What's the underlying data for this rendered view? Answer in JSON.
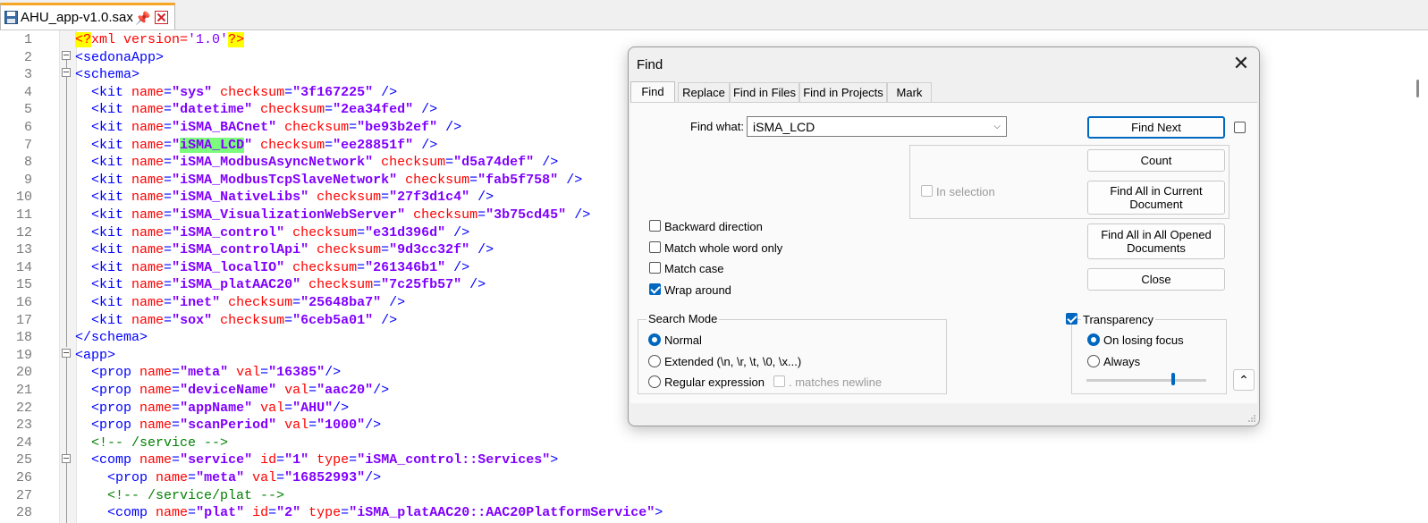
{
  "tab": {
    "filename": "AHU_app-v1.0.sax"
  },
  "editor": {
    "lines": [
      {
        "n": "1",
        "html": "<span class='pi'>&lt;?</span><span class='pit'>xml version=</span><span class='v' style='font-weight:normal;color:#8000ff'>'1.0'</span><span class='pi'>?&gt;</span>"
      },
      {
        "n": "2",
        "html": "<span class='t'>&lt;sedonaApp&gt;</span>"
      },
      {
        "n": "3",
        "html": "<span class='t'>&lt;schema&gt;</span>"
      },
      {
        "n": "4",
        "html": "  <span class='t'>&lt;kit </span><span class='a'>name</span><span class='t'>=</span><span class='v'>\"sys\"</span> <span class='a'>checksum</span><span class='t'>=</span><span class='v'>\"3f167225\"</span> <span class='t'>/&gt;</span>"
      },
      {
        "n": "5",
        "html": "  <span class='t'>&lt;kit </span><span class='a'>name</span><span class='t'>=</span><span class='v'>\"datetime\"</span> <span class='a'>checksum</span><span class='t'>=</span><span class='v'>\"2ea34fed\"</span> <span class='t'>/&gt;</span>"
      },
      {
        "n": "6",
        "html": "  <span class='t'>&lt;kit </span><span class='a'>name</span><span class='t'>=</span><span class='v'>\"iSMA_BACnet\"</span> <span class='a'>checksum</span><span class='t'>=</span><span class='v'>\"be93b2ef\"</span> <span class='t'>/&gt;</span>"
      },
      {
        "n": "7",
        "html": "  <span class='t'>&lt;kit </span><span class='a'>name</span><span class='t'>=</span><span class='v'>\"<span class='hl'>iSMA_LCD</span>\"</span> <span class='a'>checksum</span><span class='t'>=</span><span class='v'>\"ee28851f\"</span> <span class='t'>/&gt;</span>"
      },
      {
        "n": "8",
        "html": "  <span class='t'>&lt;kit </span><span class='a'>name</span><span class='t'>=</span><span class='v'>\"iSMA_ModbusAsyncNetwork\"</span> <span class='a'>checksum</span><span class='t'>=</span><span class='v'>\"d5a74def\"</span> <span class='t'>/&gt;</span>"
      },
      {
        "n": "9",
        "html": "  <span class='t'>&lt;kit </span><span class='a'>name</span><span class='t'>=</span><span class='v'>\"iSMA_ModbusTcpSlaveNetwork\"</span> <span class='a'>checksum</span><span class='t'>=</span><span class='v'>\"fab5f758\"</span> <span class='t'>/&gt;</span>"
      },
      {
        "n": "10",
        "html": "  <span class='t'>&lt;kit </span><span class='a'>name</span><span class='t'>=</span><span class='v'>\"iSMA_NativeLibs\"</span> <span class='a'>checksum</span><span class='t'>=</span><span class='v'>\"27f3d1c4\"</span> <span class='t'>/&gt;</span>"
      },
      {
        "n": "11",
        "html": "  <span class='t'>&lt;kit </span><span class='a'>name</span><span class='t'>=</span><span class='v'>\"iSMA_VisualizationWebServer\"</span> <span class='a'>checksum</span><span class='t'>=</span><span class='v'>\"3b75cd45\"</span> <span class='t'>/&gt;</span>"
      },
      {
        "n": "12",
        "html": "  <span class='t'>&lt;kit </span><span class='a'>name</span><span class='t'>=</span><span class='v'>\"iSMA_control\"</span> <span class='a'>checksum</span><span class='t'>=</span><span class='v'>\"e31d396d\"</span> <span class='t'>/&gt;</span>"
      },
      {
        "n": "13",
        "html": "  <span class='t'>&lt;kit </span><span class='a'>name</span><span class='t'>=</span><span class='v'>\"iSMA_controlApi\"</span> <span class='a'>checksum</span><span class='t'>=</span><span class='v'>\"9d3cc32f\"</span> <span class='t'>/&gt;</span>"
      },
      {
        "n": "14",
        "html": "  <span class='t'>&lt;kit </span><span class='a'>name</span><span class='t'>=</span><span class='v'>\"iSMA_localIO\"</span> <span class='a'>checksum</span><span class='t'>=</span><span class='v'>\"261346b1\"</span> <span class='t'>/&gt;</span>"
      },
      {
        "n": "15",
        "html": "  <span class='t'>&lt;kit </span><span class='a'>name</span><span class='t'>=</span><span class='v'>\"iSMA_platAAC20\"</span> <span class='a'>checksum</span><span class='t'>=</span><span class='v'>\"7c25fb57\"</span> <span class='t'>/&gt;</span>"
      },
      {
        "n": "16",
        "html": "  <span class='t'>&lt;kit </span><span class='a'>name</span><span class='t'>=</span><span class='v'>\"inet\"</span> <span class='a'>checksum</span><span class='t'>=</span><span class='v'>\"25648ba7\"</span> <span class='t'>/&gt;</span>"
      },
      {
        "n": "17",
        "html": "  <span class='t'>&lt;kit </span><span class='a'>name</span><span class='t'>=</span><span class='v'>\"sox\"</span> <span class='a'>checksum</span><span class='t'>=</span><span class='v'>\"6ceb5a01\"</span> <span class='t'>/&gt;</span>"
      },
      {
        "n": "18",
        "html": "<span class='t'>&lt;/schema&gt;</span>"
      },
      {
        "n": "19",
        "html": "<span class='t'>&lt;app&gt;</span>"
      },
      {
        "n": "20",
        "html": "  <span class='t'>&lt;prop </span><span class='a'>name</span><span class='t'>=</span><span class='v'>\"meta\"</span> <span class='a'>val</span><span class='t'>=</span><span class='v'>\"16385\"</span><span class='t'>/&gt;</span>"
      },
      {
        "n": "21",
        "html": "  <span class='t'>&lt;prop </span><span class='a'>name</span><span class='t'>=</span><span class='v'>\"deviceName\"</span> <span class='a'>val</span><span class='t'>=</span><span class='v'>\"aac20\"</span><span class='t'>/&gt;</span>"
      },
      {
        "n": "22",
        "html": "  <span class='t'>&lt;prop </span><span class='a'>name</span><span class='t'>=</span><span class='v'>\"appName\"</span> <span class='a'>val</span><span class='t'>=</span><span class='v'>\"AHU\"</span><span class='t'>/&gt;</span>"
      },
      {
        "n": "23",
        "html": "  <span class='t'>&lt;prop </span><span class='a'>name</span><span class='t'>=</span><span class='v'>\"scanPeriod\"</span> <span class='a'>val</span><span class='t'>=</span><span class='v'>\"1000\"</span><span class='t'>/&gt;</span>"
      },
      {
        "n": "24",
        "html": "  <span class='cm'>&lt;!-- /service --&gt;</span>"
      },
      {
        "n": "25",
        "html": "  <span class='t'>&lt;comp </span><span class='a'>name</span><span class='t'>=</span><span class='v'>\"service\"</span> <span class='a'>id</span><span class='t'>=</span><span class='v'>\"1\"</span> <span class='a'>type</span><span class='t'>=</span><span class='v'>\"iSMA_control::Services\"</span><span class='t'>&gt;</span>"
      },
      {
        "n": "26",
        "html": "    <span class='t'>&lt;prop </span><span class='a'>name</span><span class='t'>=</span><span class='v'>\"meta\"</span> <span class='a'>val</span><span class='t'>=</span><span class='v'>\"16852993\"</span><span class='t'>/&gt;</span>"
      },
      {
        "n": "27",
        "html": "    <span class='cm'>&lt;!-- /service/plat --&gt;</span>"
      },
      {
        "n": "28",
        "html": "    <span class='t'>&lt;comp </span><span class='a'>name</span><span class='t'>=</span><span class='v'>\"plat\"</span> <span class='a'>id</span><span class='t'>=</span><span class='v'>\"2\"</span> <span class='a'>type</span><span class='t'>=</span><span class='v'>\"iSMA_platAAC20::AAC20PlatformService\"</span><span class='t'>&gt;</span>"
      }
    ]
  },
  "find": {
    "title": "Find",
    "tabs": [
      "Find",
      "Replace",
      "Find in Files",
      "Find in Projects",
      "Mark"
    ],
    "find_what_label": "Find what:",
    "find_what_value": "iSMA_LCD",
    "buttons": {
      "find_next": "Find Next",
      "count": "Count",
      "find_all_current": "Find All in Current Document",
      "find_all_opened": "Find All in All Opened Documents",
      "close": "Close"
    },
    "in_selection": "In selection",
    "options": {
      "backward": "Backward direction",
      "whole_word": "Match whole word only",
      "match_case": "Match case",
      "wrap_around": "Wrap around"
    },
    "search_mode": {
      "label": "Search Mode",
      "normal": "Normal",
      "extended": "Extended (\\n, \\r, \\t, \\0, \\x...)",
      "regex": "Regular expression",
      "matches_newline": ". matches newline"
    },
    "transparency": {
      "label": "Transparency",
      "on_losing_focus": "On losing focus",
      "always": "Always",
      "level": 0.73
    }
  }
}
